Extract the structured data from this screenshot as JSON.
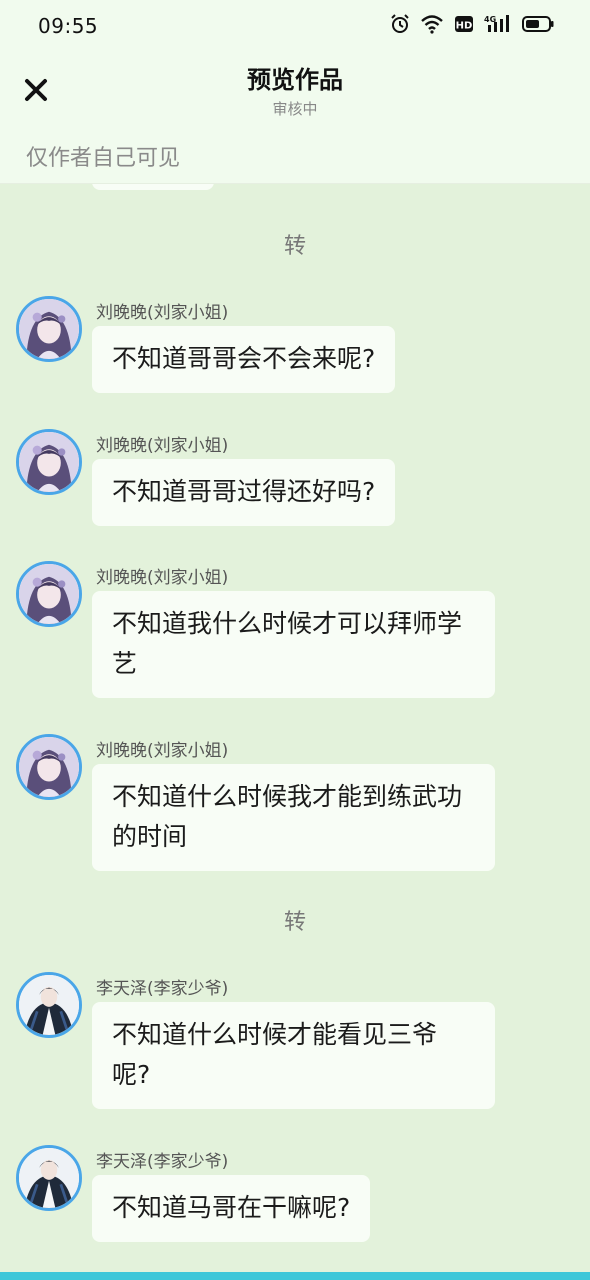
{
  "status_bar": {
    "time": "09:55",
    "icons": [
      "alarm-icon",
      "wifi-icon",
      "hd-icon",
      "signal-4g-icon",
      "battery-icon"
    ],
    "network_label": "4G",
    "hd_label": "HD"
  },
  "header": {
    "close_icon": "close-icon",
    "title": "预览作品",
    "subtitle": "审核中",
    "visibility_note": "仅作者自己可见"
  },
  "dividers": [
    "转",
    "转"
  ],
  "messages": [
    {
      "sender": "刘晚晚(刘家小姐)",
      "text": "不知道哥哥会不会来呢?"
    },
    {
      "sender": "刘晚晚(刘家小姐)",
      "text": "不知道哥哥过得还好吗?"
    },
    {
      "sender": "刘晚晚(刘家小姐)",
      "text": "不知道我什么时候才可以拜师学艺"
    },
    {
      "sender": "刘晚晚(刘家小姐)",
      "text": "不知道什么时候我才能到练武功的时间"
    },
    {
      "sender": "李天泽(李家少爷)",
      "text": "不知道什么时候才能看见三爷呢?"
    },
    {
      "sender": "李天泽(李家少爷)",
      "text": "不知道马哥在干嘛呢?"
    }
  ],
  "colors": {
    "background": "#e3f2db",
    "header_bg": "#f1fbee",
    "bubble_bg": "#f8fdf6",
    "avatar_border": "#4aa6e8",
    "bottom_strip": "#3ec7d9"
  }
}
